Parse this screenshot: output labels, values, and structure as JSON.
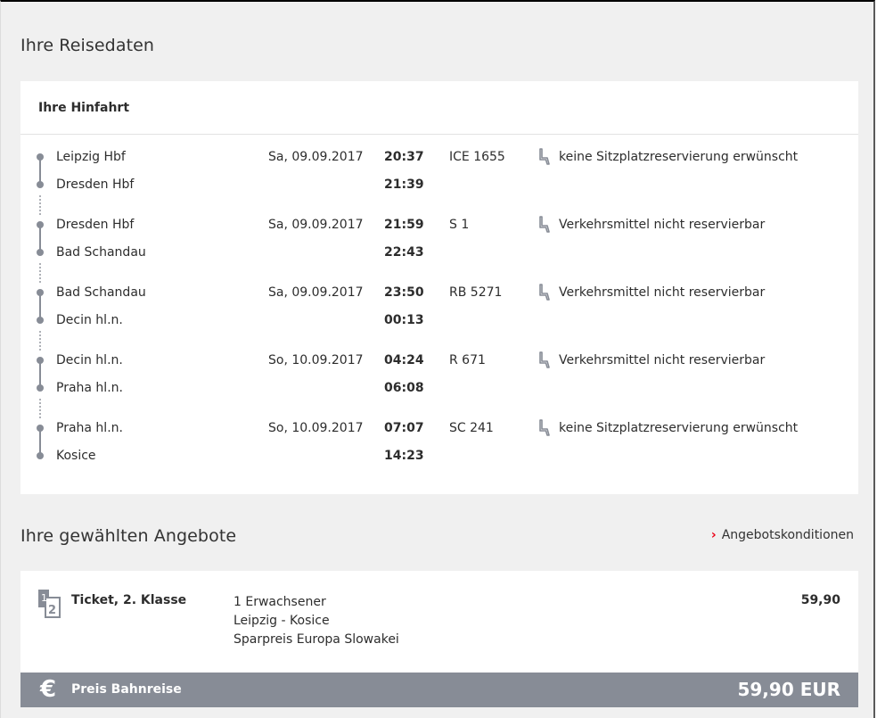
{
  "travel": {
    "heading": "Ihre Reisedaten",
    "outbound_title": "Ihre Hinfahrt",
    "segments": [
      {
        "from": "Leipzig Hbf",
        "to": "Dresden Hbf",
        "date": "Sa, 09.09.2017",
        "dep": "20:37",
        "arr": "21:39",
        "train": "ICE 1655",
        "reservation": "keine Sitzplatzreservierung erwünscht"
      },
      {
        "from": "Dresden Hbf",
        "to": "Bad Schandau",
        "date": "Sa, 09.09.2017",
        "dep": "21:59",
        "arr": "22:43",
        "train": "S 1",
        "reservation": "Verkehrsmittel nicht reservierbar"
      },
      {
        "from": "Bad Schandau",
        "to": "Decin hl.n.",
        "date": "Sa, 09.09.2017",
        "dep": "23:50",
        "arr": "00:13",
        "train": "RB 5271",
        "reservation": "Verkehrsmittel nicht reservierbar"
      },
      {
        "from": "Decin hl.n.",
        "to": "Praha hl.n.",
        "date": "So, 10.09.2017",
        "dep": "04:24",
        "arr": "06:08",
        "train": "R 671",
        "reservation": "Verkehrsmittel nicht reservierbar"
      },
      {
        "from": "Praha hl.n.",
        "to": "Kosice",
        "date": "So, 10.09.2017",
        "dep": "07:07",
        "arr": "14:23",
        "train": "SC 241",
        "reservation": "keine Sitzplatzreservierung erwünscht"
      }
    ]
  },
  "offers": {
    "heading": "Ihre gewählten Angebote",
    "conditions_link": "Angebotskonditionen",
    "ticket": {
      "icon_top": "1",
      "icon_bottom": "2",
      "title": "Ticket, 2. Klasse",
      "passengers": "1 Erwachsener",
      "route": "Leipzig - Kosice",
      "fare": "Sparpreis Europa Slowakei",
      "price": "59,90"
    }
  },
  "total": {
    "symbol": "€",
    "label": "Preis Bahnreise",
    "value": "59,90 EUR"
  },
  "colors": {
    "accent_red": "#ec0016",
    "timeline_grey": "#878c96",
    "background": "#f0f0f0"
  }
}
